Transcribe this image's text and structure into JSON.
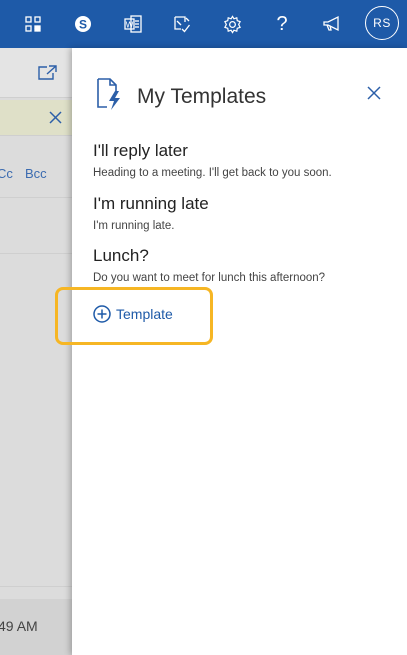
{
  "topbar": {
    "icons": [
      "qr-code-icon",
      "skype-icon",
      "office-docs-icon",
      "edit-check-icon",
      "gear-icon",
      "help-icon",
      "megaphone-icon"
    ],
    "help_label": "?",
    "avatar_initials": "RS",
    "bar_color": "#1e5aa8"
  },
  "compose": {
    "cc_label": "Cc",
    "bcc_label": "Bcc",
    "time_text": "49 AM"
  },
  "panel": {
    "title": "My Templates",
    "templates": [
      {
        "title": "I'll reply later",
        "body": "Heading to a meeting. I'll get back to you soon."
      },
      {
        "title": "I'm running late",
        "body": "I'm running late."
      },
      {
        "title": "Lunch?",
        "body": "Do you want to meet for lunch this afternoon?"
      }
    ],
    "add_label": "Template",
    "highlight_color": "#f6b624"
  }
}
